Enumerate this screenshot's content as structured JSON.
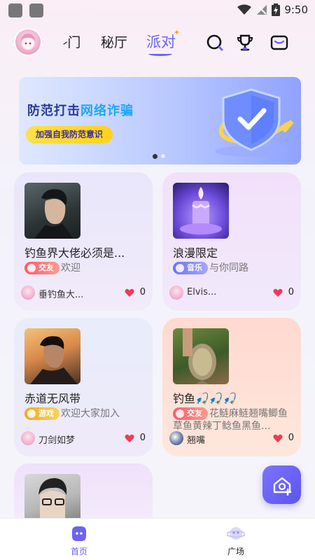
{
  "status_bar": {
    "time": "9:50"
  },
  "top_nav": {
    "tabs": [
      {
        "label": "进门",
        "visible_label": "⹝门"
      },
      {
        "label": "秘厅"
      },
      {
        "label": "派对",
        "active": true
      }
    ],
    "icons": [
      "search-icon",
      "trophy-icon",
      "mail-icon"
    ],
    "accent": "#6c63f0"
  },
  "banner": {
    "title_prefix": "防范打击",
    "title_highlight": "网络诈骗",
    "pill": "加强自我防范意识",
    "page_index": 0,
    "page_count": 2
  },
  "cards": [
    {
      "title": "钓鱼界大佬必须是...",
      "tag": "交友",
      "tag_color": "#ff6a6a",
      "tagline": "欢迎",
      "owner": "垂钓鱼大...",
      "likes": "0",
      "thumb": "man-portrait"
    },
    {
      "title": "浪漫限定",
      "tag": "音乐",
      "tag_color": "#7a7cf5",
      "tagline": "与你同路",
      "owner": "Elvis...",
      "likes": "0",
      "thumb": "candle"
    },
    {
      "title": "赤道无风带",
      "tag": "游戏",
      "tag_color": "#f7b733",
      "tagline": "欢迎大家加入",
      "owner": "刀剑如梦",
      "likes": "0",
      "thumb": "man-portrait-2"
    },
    {
      "title": "钓鱼🎣🎣🎣",
      "tag": "交友",
      "tag_color": "#ff6a6a",
      "tagline": "花鲢麻鲢翘嘴鲫鱼草鱼黄辣丁鲶鱼黑鱼...",
      "owner": "翘嘴",
      "likes": "0",
      "thumb": "fish"
    }
  ],
  "bottom_nav": {
    "items": [
      {
        "label": "首页",
        "active": true
      },
      {
        "label": "广场",
        "active": false
      }
    ]
  }
}
